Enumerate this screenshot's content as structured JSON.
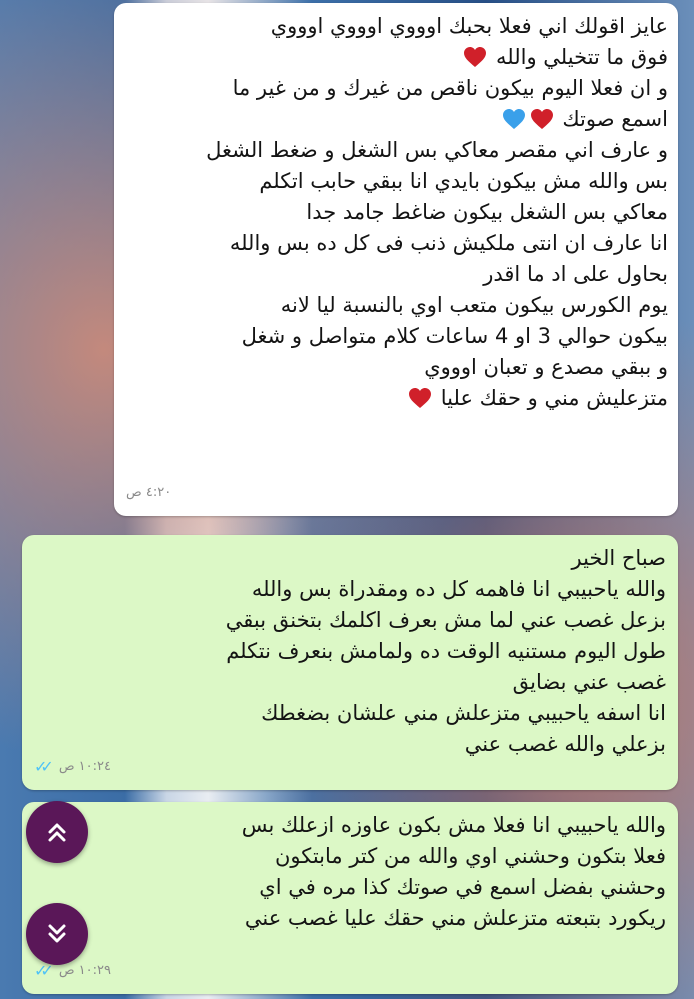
{
  "incoming_message": {
    "lines": [
      "عايز اقولك اني فعلا بحبك اوووي اوووي اوووي",
      "فوق ما تتخيلي والله",
      "و ان فعلا اليوم بيكون ناقص من غيرك و من غير ما",
      "اسمع صوتك",
      "و عارف اني مقصر معاكي بس الشغل و ضغط الشغل",
      "بس والله مش بيكون بايدي انا ببقي حابب اتكلم",
      "معاكي بس الشغل بيكون ضاغط جامد جدا",
      "انا عارف ان انتى ملكيش ذنب فى كل ده بس والله",
      "بحاول على اد ما اقدر",
      "يوم الكورس بيكون متعب اوي بالنسبة ليا لانه",
      "بيكون حوالي 3 او 4 ساعات كلام متواصل و شغل",
      "و ببقي مصدع و تعبان اوووي",
      "متزعليش مني و حقك عليا"
    ],
    "time": "٤:٢٠ ص",
    "heart_colors": {
      "red": "#d0202a",
      "blue": "#3aa0ea"
    }
  },
  "outgoing_message_1": {
    "lines": [
      "صباح الخير",
      "والله ياحبيبي انا فاهمه كل ده ومقدراة بس والله",
      "بزعل غصب عني لما مش بعرف اكلمك بتخنق ببقي",
      "طول اليوم مستنيه الوقت ده ولمامش بنعرف نتكلم",
      "غصب عني بضايق",
      "انا اسفه ياحبيبي متزعلش مني علشان بضغطك",
      "بزعلي والله غصب عني"
    ],
    "time": "١٠:٢٤ ص",
    "status": "read"
  },
  "outgoing_message_2": {
    "lines": [
      "والله ياحبيبي انا فعلا مش بكون عاوزه ازعلك بس",
      "فعلا بتكون وحشني اوي والله من كتر مابتكون",
      "وحشني بفضل اسمع في صوتك كذا مره في اي",
      "ريكورد بتبعته متزعلش مني حقك عليا غصب عني"
    ],
    "time": "١٠:٢٩ ص",
    "status": "read"
  },
  "controls": {
    "scroll_up_icon": "double-chevron-up",
    "scroll_down_icon": "double-chevron-down",
    "button_color": "#5a1758"
  },
  "colors": {
    "incoming_bubble": "#ffffff",
    "outgoing_bubble": "#dcf8c6",
    "read_ticks": "#4fc3f7"
  }
}
